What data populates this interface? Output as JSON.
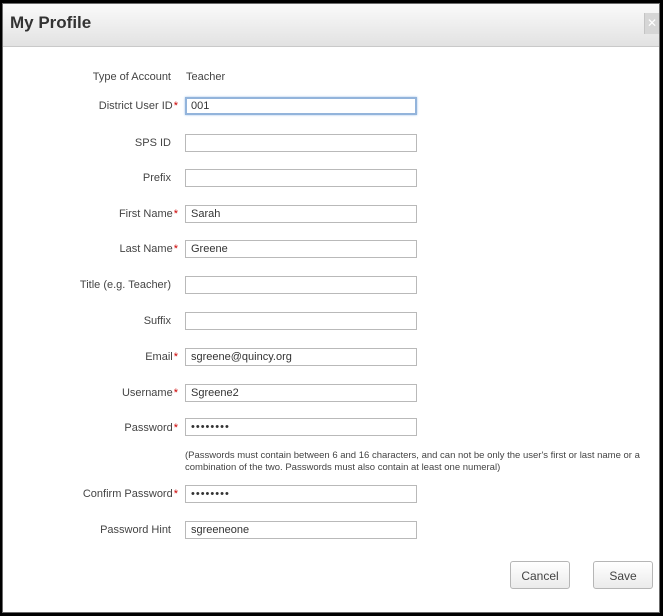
{
  "dialog": {
    "title": "My Profile",
    "close_icon": "close-icon"
  },
  "form": {
    "type_of_account": {
      "label": "Type of Account",
      "value": "Teacher"
    },
    "district_user_id": {
      "label": "District User ID",
      "required": "*",
      "value": "001"
    },
    "sps_id": {
      "label": "SPS ID",
      "value": ""
    },
    "prefix": {
      "label": "Prefix",
      "value": ""
    },
    "first_name": {
      "label": "First Name",
      "required": "*",
      "value": "Sarah"
    },
    "last_name": {
      "label": "Last Name",
      "required": "*",
      "value": "Greene"
    },
    "title": {
      "label": "Title (e.g. Teacher)",
      "value": ""
    },
    "suffix": {
      "label": "Suffix",
      "value": ""
    },
    "email": {
      "label": "Email",
      "required": "*",
      "value": "sgreene@quincy.org"
    },
    "username": {
      "label": "Username",
      "required": "*",
      "value": "Sgreene2"
    },
    "password": {
      "label": "Password",
      "required": "*",
      "value": "••••••••"
    },
    "password_note": "(Passwords must contain between 6 and 16 characters, and can not be only the user's first or last name or a combination of the two. Passwords must also contain at least one numeral)",
    "confirm_password": {
      "label": "Confirm Password",
      "required": "*",
      "value": "••••••••"
    },
    "password_hint": {
      "label": "Password Hint",
      "value": "sgreeneone"
    }
  },
  "buttons": {
    "cancel": "Cancel",
    "save": "Save"
  }
}
